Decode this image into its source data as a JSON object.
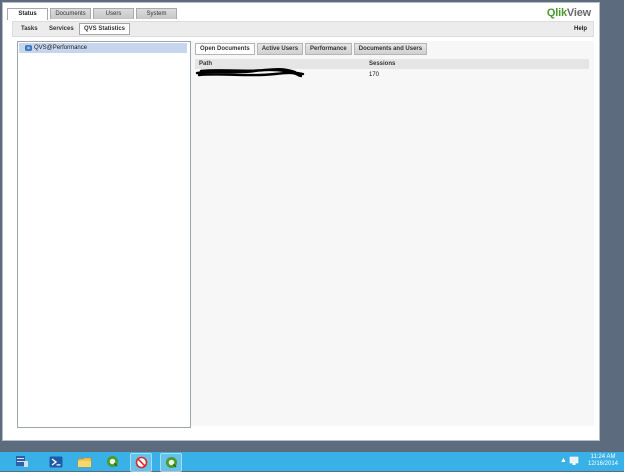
{
  "app": {
    "logo_qlik": "Qlik",
    "logo_view": "View",
    "top_tabs": [
      {
        "label": "Status",
        "active": true
      },
      {
        "label": "Documents",
        "active": false
      },
      {
        "label": "Users",
        "active": false
      },
      {
        "label": "System",
        "active": false
      }
    ],
    "sub_tabs": [
      {
        "label": "Tasks",
        "active": false
      },
      {
        "label": "Services",
        "active": false
      },
      {
        "label": "QVS Statistics",
        "active": true
      }
    ],
    "help_label": "Help"
  },
  "tree": {
    "items": [
      {
        "label": "QVS@Performance",
        "selected": true,
        "icon": "server-icon"
      }
    ]
  },
  "detail": {
    "tabs": [
      {
        "label": "Open Documents",
        "active": true
      },
      {
        "label": "Active Users",
        "active": false
      },
      {
        "label": "Performance",
        "active": false
      },
      {
        "label": "Documents and Users",
        "active": false
      }
    ],
    "columns": {
      "path": "Path",
      "sessions": "Sessions"
    },
    "rows": [
      {
        "path": "",
        "path_redacted": true,
        "sessions": "170"
      }
    ]
  },
  "taskbar": {
    "icons": [
      "server-manager-icon",
      "powershell-icon",
      "file-explorer-icon",
      "qlikview-icon",
      "no-entry-icon",
      "qlikview-icon"
    ],
    "clock_time": "11:24 AM",
    "clock_date": "12/16/2014"
  },
  "colors": {
    "accent_green": "#4a9a2c",
    "taskbar": "#39b1e6",
    "desktop": "#5c6b7e",
    "selection": "#c6d6ee"
  }
}
